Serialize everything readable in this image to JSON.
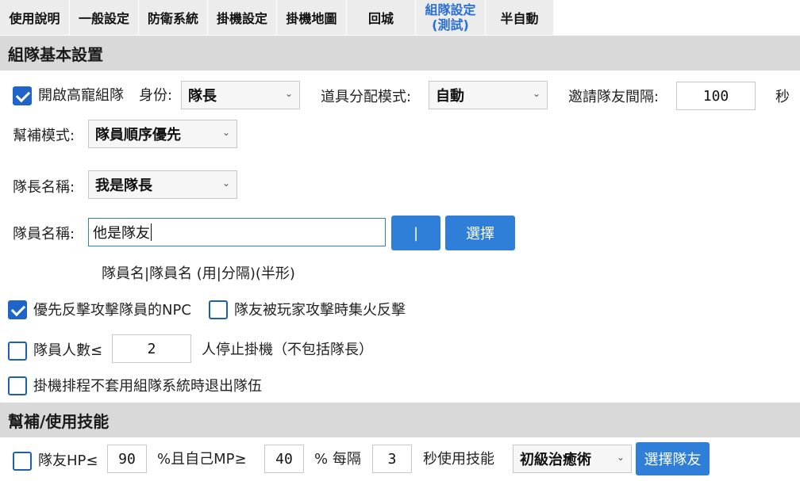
{
  "tabs": [
    {
      "label": "使用說明"
    },
    {
      "label": "一般設定"
    },
    {
      "label": "防衛系統"
    },
    {
      "label": "掛機設定"
    },
    {
      "label": "掛機地圖"
    },
    {
      "label": "回城"
    },
    {
      "label_line1": "組隊設定",
      "label_line2": "(測試)"
    },
    {
      "label": "半自動"
    }
  ],
  "section1": {
    "title": "組隊基本設置",
    "enable_party_label": "開啟高寵組隊",
    "enable_party_checked": true,
    "identity_label": "身份:",
    "identity_value": "隊長",
    "item_mode_label": "道具分配模式:",
    "item_mode_value": "自動",
    "invite_interval_label": "邀請隊友間隔:",
    "invite_interval_value": "100",
    "invite_interval_unit": "秒",
    "help_mode_label": "幫補模式:",
    "help_mode_value": "隊員順序優先",
    "leader_name_label": "隊長名稱:",
    "leader_name_value": "我是隊長",
    "member_name_label": "隊員名稱:",
    "member_name_value": "他是隊友",
    "separator_button": "|",
    "select_button": "選擇",
    "member_hint": "隊員名|隊員名 (用|分隔)(半形)",
    "counter_npc_label": "優先反擊攻擊隊員的NPC",
    "counter_npc_checked": true,
    "focus_fire_label": "隊友被玩家攻擊時集火反擊",
    "focus_fire_checked": false,
    "member_count_label": "隊員人數≤",
    "member_count_checked": false,
    "member_count_value": "2",
    "member_count_suffix": "人停止掛機（不包括隊長）",
    "schedule_exit_label": "掛機排程不套用組隊系統時退出隊伍",
    "schedule_exit_checked": false
  },
  "section2": {
    "title": "幫補/使用技能",
    "hp_label": "隊友HP≤",
    "hp_checked": false,
    "hp_value": "90",
    "mp_label": "%且自己MP≥",
    "mp_value": "40",
    "every_label": "% 每隔",
    "every_value": "3",
    "use_skill_label": "秒使用技能",
    "skill_value": "初級治癒術",
    "select_member_button": "選擇隊友"
  }
}
